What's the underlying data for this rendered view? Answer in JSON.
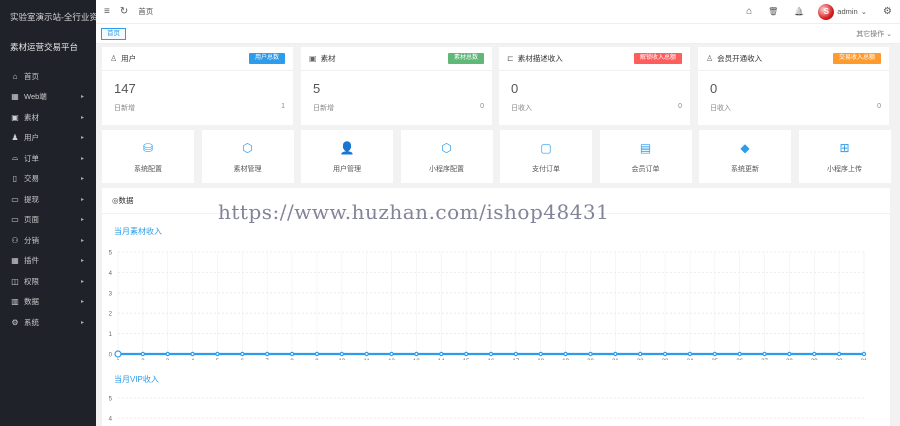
{
  "sidebar": {
    "title": "实验室演示站-全行业资源",
    "subtitle": "素材运营交易平台",
    "items": [
      {
        "label": "首页",
        "icon": "home-icon",
        "glyph": "⌂",
        "arrow": ""
      },
      {
        "label": "Web端",
        "icon": "grid-icon",
        "glyph": "▦",
        "arrow": "▸"
      },
      {
        "label": "素材",
        "icon": "image-icon",
        "glyph": "▣",
        "arrow": "▸"
      },
      {
        "label": "用户",
        "icon": "user-icon",
        "glyph": "♟",
        "arrow": "▸"
      },
      {
        "label": "订单",
        "icon": "cart-icon",
        "glyph": "⌓",
        "arrow": "▸"
      },
      {
        "label": "交易",
        "icon": "wallet-icon",
        "glyph": "▯",
        "arrow": "▸"
      },
      {
        "label": "提现",
        "icon": "card-icon",
        "glyph": "▭",
        "arrow": "▸"
      },
      {
        "label": "页面",
        "icon": "page-icon",
        "glyph": "▭",
        "arrow": "▸"
      },
      {
        "label": "分销",
        "icon": "share-icon",
        "glyph": "⚇",
        "arrow": "▸"
      },
      {
        "label": "插件",
        "icon": "apps-icon",
        "glyph": "▦",
        "arrow": "▸"
      },
      {
        "label": "权限",
        "icon": "shield-icon",
        "glyph": "◫",
        "arrow": "▸"
      },
      {
        "label": "数据",
        "icon": "chart-icon",
        "glyph": "▥",
        "arrow": "▸"
      },
      {
        "label": "系统",
        "icon": "gear-icon",
        "glyph": "⚙",
        "arrow": "▸"
      }
    ]
  },
  "header": {
    "breadcrumb": "首页",
    "username": "admin",
    "avatar_text": "S",
    "menu_glyph": "≡",
    "refresh_glyph": "↻",
    "home_glyph": "⌂",
    "trash_glyph": "🗑",
    "bell_glyph": "🔔",
    "settings_glyph": "⚙",
    "user_arrow": "⌄"
  },
  "tabs": {
    "home": "首页",
    "ops": "其它操作 ⌄"
  },
  "stats": [
    {
      "title": "用户",
      "icon": "user-icon",
      "glyph": "♙",
      "badge": "用户总数",
      "badge_color": "#2e9cea",
      "value": "147",
      "foot_label": "日新增",
      "foot_value": "1"
    },
    {
      "title": "素材",
      "icon": "image-icon",
      "glyph": "▣",
      "badge": "素材总数",
      "badge_color": "#5fb878",
      "value": "5",
      "foot_label": "日新增",
      "foot_value": "0"
    },
    {
      "title": "素材描述收入",
      "icon": "folder-icon",
      "glyph": "⊏",
      "badge": "解锁收入总额",
      "badge_color": "#ff5c5c",
      "value": "0",
      "foot_label": "日收入",
      "foot_value": "0"
    },
    {
      "title": "会员开通收入",
      "icon": "member-icon",
      "glyph": "♙",
      "badge": "交易收入总额",
      "badge_color": "#ff9a2e",
      "value": "0",
      "foot_label": "日收入",
      "foot_value": "0"
    }
  ],
  "tiles": [
    {
      "label": "系统配置",
      "icon": "config-icon",
      "glyph": "⛁"
    },
    {
      "label": "素材管理",
      "icon": "box-icon",
      "glyph": "⬡"
    },
    {
      "label": "用户管理",
      "icon": "user-icon",
      "glyph": "👤"
    },
    {
      "label": "小程序配置",
      "icon": "cube-icon",
      "glyph": "⬡"
    },
    {
      "label": "支付订单",
      "icon": "order-icon",
      "glyph": "▢"
    },
    {
      "label": "会员订单",
      "icon": "doc-icon",
      "glyph": "▤"
    },
    {
      "label": "系统更新",
      "icon": "layers-icon",
      "glyph": "◆"
    },
    {
      "label": "小程序上传",
      "icon": "grid-icon",
      "glyph": "⊞"
    }
  ],
  "panel": {
    "title": "◎数据",
    "watermark": "https://www.huzhan.com/ishop48431"
  },
  "colors": {
    "accent": "#2e9cea",
    "sidebar_bg": "#20222a"
  },
  "chart_data": [
    {
      "type": "line",
      "title": "当月素材收入",
      "x": [
        1,
        2,
        3,
        4,
        5,
        6,
        7,
        8,
        9,
        10,
        11,
        12,
        13,
        14,
        15,
        16,
        17,
        18,
        19,
        20,
        21,
        22,
        23,
        24,
        25,
        26,
        27,
        28,
        29,
        30,
        31
      ],
      "series": [
        {
          "values": [
            0,
            0,
            0,
            0,
            0,
            0,
            0,
            0,
            0,
            0,
            0,
            0,
            0,
            0,
            0,
            0,
            0,
            0,
            0,
            0,
            0,
            0,
            0,
            0,
            0,
            0,
            0,
            0,
            0,
            0,
            0
          ]
        }
      ],
      "yticks": [
        0,
        1,
        2,
        3,
        4,
        5
      ],
      "ylim": [
        0,
        5
      ],
      "grid": true
    },
    {
      "type": "line",
      "title": "当月VIP收入",
      "yticks": [
        4,
        5
      ],
      "ylim": [
        0,
        5
      ],
      "grid": true
    }
  ]
}
